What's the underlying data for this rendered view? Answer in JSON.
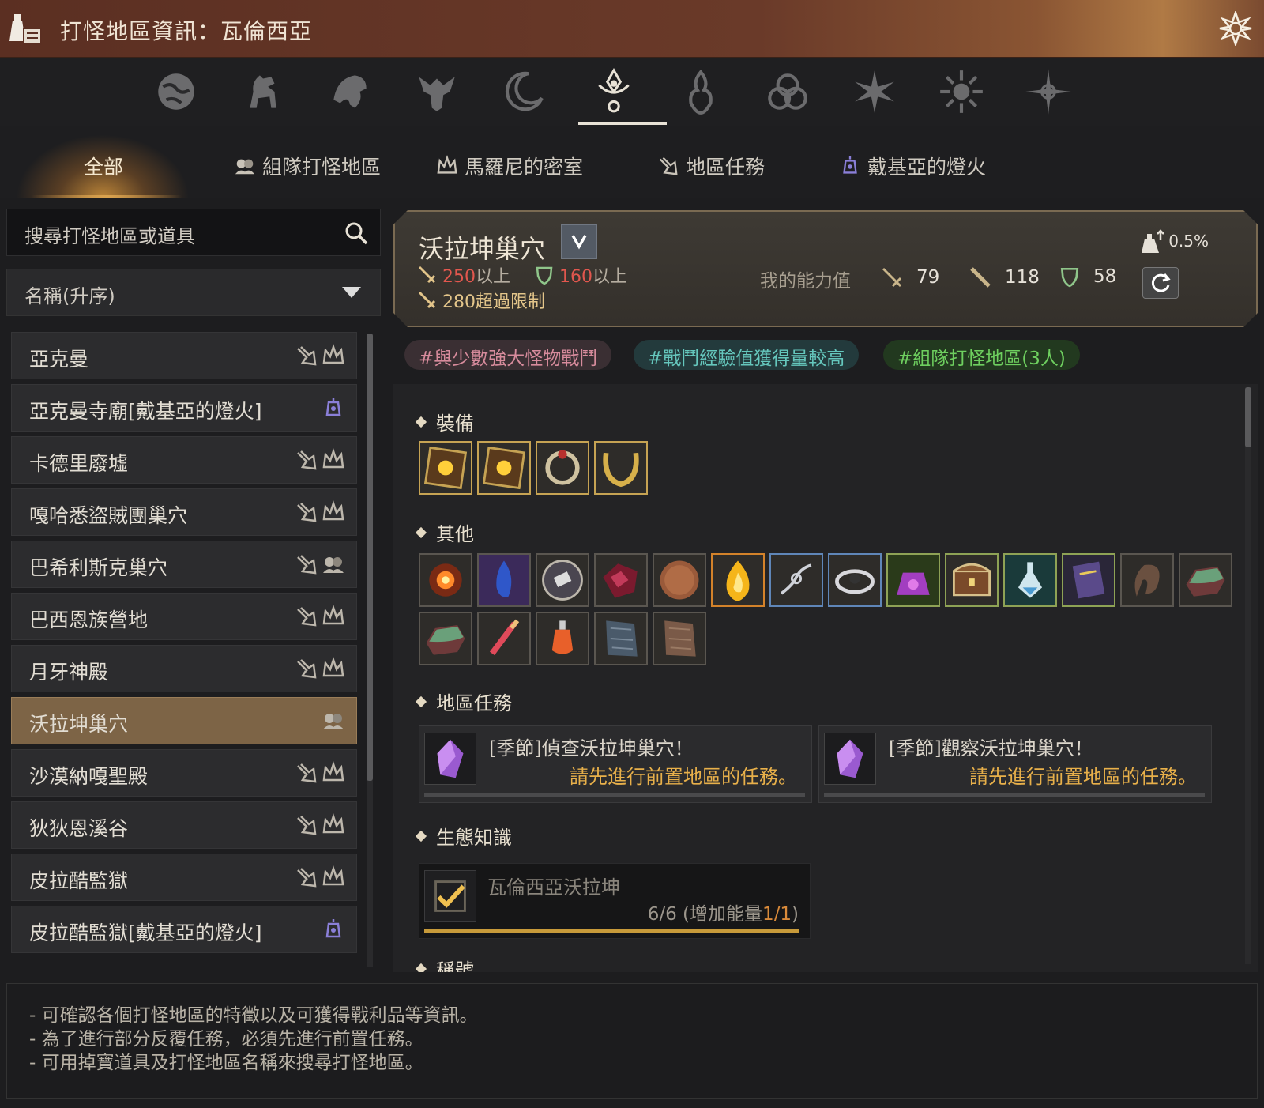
{
  "window": {
    "title": "打怪地區資訊：瓦倫西亞",
    "icon": "potion-scroll-icon",
    "close_icon": "ornate-close-icon"
  },
  "categories": [
    {
      "icon": "globe-icon"
    },
    {
      "icon": "horse-icon"
    },
    {
      "icon": "griffin-icon"
    },
    {
      "icon": "winged-crest-icon"
    },
    {
      "icon": "crescent-moon-icon"
    },
    {
      "icon": "valencia-emblem-icon",
      "active": true
    },
    {
      "icon": "flame-crest-icon"
    },
    {
      "icon": "triquetra-icon"
    },
    {
      "icon": "star-burst-icon"
    },
    {
      "icon": "sun-burst-icon"
    },
    {
      "icon": "compass-star-icon"
    }
  ],
  "tabs": [
    {
      "label": "全部",
      "icon": "",
      "active": true
    },
    {
      "label": "組隊打怪地區",
      "icon": "party-icon"
    },
    {
      "label": "馬羅尼的密室",
      "icon": "crown-icon"
    },
    {
      "label": "地區任務",
      "icon": "quest-icon"
    },
    {
      "label": "戴基亞的燈火",
      "icon": "lantern-icon"
    }
  ],
  "search": {
    "placeholder": "搜尋打怪地區或道具",
    "icon": "search-icon"
  },
  "sort": {
    "value": "名稱(升序)",
    "icon": "chevron-down-icon"
  },
  "zones": [
    {
      "name": "亞克曼",
      "icons": [
        "quest-icon",
        "crown-icon"
      ]
    },
    {
      "name": "亞克曼寺廟[戴基亞的燈火]",
      "icons": [
        "lantern-icon"
      ]
    },
    {
      "name": "卡德里廢墟",
      "icons": [
        "quest-icon",
        "crown-icon"
      ]
    },
    {
      "name": "嘎哈悉盜賊團巢穴",
      "icons": [
        "quest-icon",
        "crown-icon"
      ]
    },
    {
      "name": "巴希利斯克巢穴",
      "icons": [
        "quest-icon",
        "party-icon"
      ]
    },
    {
      "name": "巴西恩族營地",
      "icons": [
        "quest-icon",
        "crown-icon"
      ]
    },
    {
      "name": "月牙神殿",
      "icons": [
        "quest-icon",
        "crown-icon"
      ]
    },
    {
      "name": "沃拉坤巢穴",
      "icons": [
        "party-icon"
      ],
      "selected": true
    },
    {
      "name": "沙漠納嘎聖殿",
      "icons": [
        "quest-icon",
        "crown-icon"
      ]
    },
    {
      "name": "狄狄恩溪谷",
      "icons": [
        "quest-icon",
        "crown-icon"
      ]
    },
    {
      "name": "皮拉酷監獄",
      "icons": [
        "quest-icon",
        "crown-icon"
      ]
    },
    {
      "name": "皮拉酷監獄[戴基亞的燈火]",
      "icons": [
        "lantern-icon"
      ]
    }
  ],
  "detail": {
    "name": "沃拉坤巢穴",
    "req_ap_value": "250",
    "req_ap_suffix": "以上",
    "req_dp_value": "160",
    "req_dp_suffix": "以上",
    "cap_value": "280",
    "cap_suffix": "超過限制",
    "my_stats_label": "我的能力值",
    "my_ap": "79",
    "my_aap": "118",
    "my_dp": "58",
    "drop_rate": "0.5%"
  },
  "tags": [
    "#與少數強大怪物戰鬥",
    "#戰鬥經驗值獲得量較高",
    "#組隊打怪地區(3人)"
  ],
  "sections": {
    "equipment": "裝備",
    "other": "其他",
    "quests": "地區任務",
    "ecology": "生態知識",
    "titles": "稱號"
  },
  "equipment_items": [
    {
      "icon": "gold-earring-cube-icon"
    },
    {
      "icon": "gold-earring-cube-icon"
    },
    {
      "icon": "ring-icon"
    },
    {
      "icon": "necklace-icon"
    }
  ],
  "other_items": [
    {
      "icon": "fire-burst-icon"
    },
    {
      "icon": "blue-gem-icon"
    },
    {
      "icon": "crystal-orb-icon"
    },
    {
      "icon": "red-ore-icon"
    },
    {
      "icon": "copper-coin-icon"
    },
    {
      "icon": "flame-gem-icon"
    },
    {
      "icon": "silver-chain-icon"
    },
    {
      "icon": "eye-ring-icon"
    },
    {
      "icon": "purple-pouch-icon"
    },
    {
      "icon": "treasure-chest-icon"
    },
    {
      "icon": "elixir-bottle-icon"
    },
    {
      "icon": "scroll-icon"
    },
    {
      "icon": "brown-fang-icon"
    },
    {
      "icon": "green-ore-icon"
    },
    {
      "icon": "green-ore-icon"
    },
    {
      "icon": "red-brush-icon"
    },
    {
      "icon": "orange-potion-icon"
    },
    {
      "icon": "blue-hide-icon"
    },
    {
      "icon": "brown-hide-icon"
    }
  ],
  "quests": [
    {
      "name": "[季節]偵查沃拉坤巢穴！",
      "note": "請先進行前置地區的任務。",
      "icon": "purple-crystal-icon"
    },
    {
      "name": "[季節]觀察沃拉坤巢穴！",
      "note": "請先進行前置地區的任務。",
      "icon": "purple-crystal-icon"
    }
  ],
  "ecology": {
    "name": "瓦倫西亞沃拉坤",
    "progress": "6/6",
    "energy_prefix": "(增加能量",
    "energy_value": "1/1",
    "energy_suffix": ")",
    "icon": "check-icon"
  },
  "info_lines": [
    "- 可確認各個打怪地區的特徵以及可獲得戰利品等資訊。",
    "- 為了進行部分反覆任務，必須先進行前置任務。",
    "- 可用掉寶道具及打怪地區名稱來搜尋打怪地區。"
  ],
  "colors": {
    "accent_gold": "#e8b04a",
    "selected_row": "#7d6446",
    "title_bar": "#5b2f22"
  }
}
